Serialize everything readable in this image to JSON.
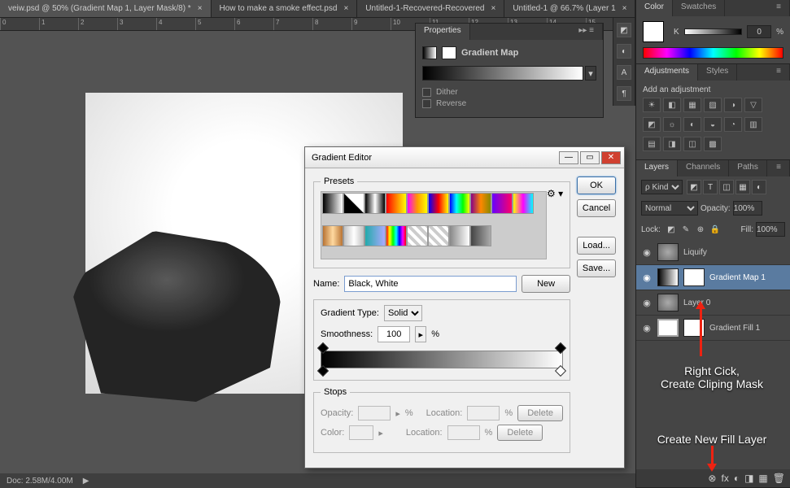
{
  "tabs": [
    {
      "label": "veiw.psd @ 50% (Gradient Map 1, Layer Mask/8) *",
      "close": "×"
    },
    {
      "label": "How to make a smoke effect.psd",
      "close": "×"
    },
    {
      "label": "Untitled-1-Recovered-Recovered",
      "close": "×"
    },
    {
      "label": "Untitled-1 @ 66.7% (Layer 1",
      "close": "×"
    }
  ],
  "ruler_ticks": [
    "0",
    "1",
    "2",
    "3",
    "4",
    "5",
    "6",
    "7",
    "8",
    "9",
    "10",
    "11",
    "12",
    "13",
    "14",
    "15"
  ],
  "statusbar": {
    "doc": "Doc: 2.58M/4.00M",
    "caret": "▶"
  },
  "properties": {
    "title": "Properties",
    "subtitle": "Gradient Map",
    "dither": "Dither",
    "reverse": "Reverse"
  },
  "color_panel": {
    "tabs": [
      "Color",
      "Swatches"
    ],
    "channel": "K",
    "value": "0",
    "pct": "%"
  },
  "adjustments_panel": {
    "tabs": [
      "Adjustments",
      "Styles"
    ],
    "hint": "Add an adjustment",
    "icons": [
      "☀",
      "◧",
      "▦",
      "▨",
      "◑",
      "▽",
      "",
      "◩",
      "☼",
      "◐",
      "◒",
      "◔",
      "▥",
      "",
      "▤",
      "◨",
      "◫",
      "▩"
    ]
  },
  "layers_panel": {
    "tabs": [
      "Layers",
      "Channels",
      "Paths"
    ],
    "filter": "ρ Kind",
    "filter_icons": [
      "◩",
      "T",
      "◫",
      "▦",
      "◐"
    ],
    "blend": "Normal",
    "opacity_label": "Opacity:",
    "opacity": "100%",
    "lock_label": "Lock:",
    "lock_icons": [
      "◩",
      "✎",
      "⊕",
      "🔒"
    ],
    "fill_label": "Fill:",
    "fill": "100%",
    "layers": [
      {
        "name": "Liquify",
        "kind": "img"
      },
      {
        "name": "Gradient Map 1",
        "kind": "gmap",
        "mask": true,
        "selected": true
      },
      {
        "name": "Layer 0",
        "kind": "img"
      },
      {
        "name": "Gradient Fill 1",
        "kind": "fill",
        "mask": true
      }
    ],
    "footer_icons": [
      "⊗",
      "fx",
      "◐",
      "◨",
      "▦",
      "🗑"
    ]
  },
  "annotations": {
    "rc_line1": "Right Cick,",
    "rc_line2": "Create Cliping Mask",
    "newfill": "Create New Fill Layer"
  },
  "gradient_editor": {
    "title": "Gradient Editor",
    "presets_label": "Presets",
    "ok": "OK",
    "cancel": "Cancel",
    "load": "Load...",
    "save": "Save...",
    "new": "New",
    "name_label": "Name:",
    "name_value": "Black, White",
    "type_label": "Gradient Type:",
    "type_value": "Solid",
    "smooth_label": "Smoothness:",
    "smooth_value": "100",
    "pct": "%",
    "stops_label": "Stops",
    "opacity_label": "Opacity:",
    "location_label": "Location:",
    "color_label": "Color:",
    "delete": "Delete",
    "preset_gradients": [
      "linear-gradient(to right,#000,#fff)",
      "linear-gradient(45deg,#000 49%,#fff 51%)",
      "linear-gradient(to right,#000,#fff,#000)",
      "linear-gradient(to right,#f00,#ff0)",
      "linear-gradient(to right,#f0f,#f90,#ff0)",
      "linear-gradient(to right,#00f,#f00,#ff0)",
      "linear-gradient(to right,#00f,#0ff,#0f0,#ff0)",
      "linear-gradient(to right,#808,#f80,#880)",
      "linear-gradient(to right,#60f,#f06)",
      "linear-gradient(to right,#ff0,#f0f,#0ff)",
      "linear-gradient(to right,#b87333,#ffd9a0,#b87333)",
      "linear-gradient(to right,#c0c0c0,#fff,#c0c0c0)",
      "linear-gradient(to right,#2aa,#aaf)",
      "linear-gradient(to right,#f00,#ff0,#0f0,#0ff,#00f,#f0f,#f00)",
      "repeating-linear-gradient(45deg,#ccc 0 4px,#fff 4px 8px)",
      "repeating-linear-gradient(45deg,#ccc 0 4px,#fff 4px 8px)",
      "linear-gradient(to right,#888,#fff)",
      "linear-gradient(to right,#444,#aaa)"
    ]
  }
}
